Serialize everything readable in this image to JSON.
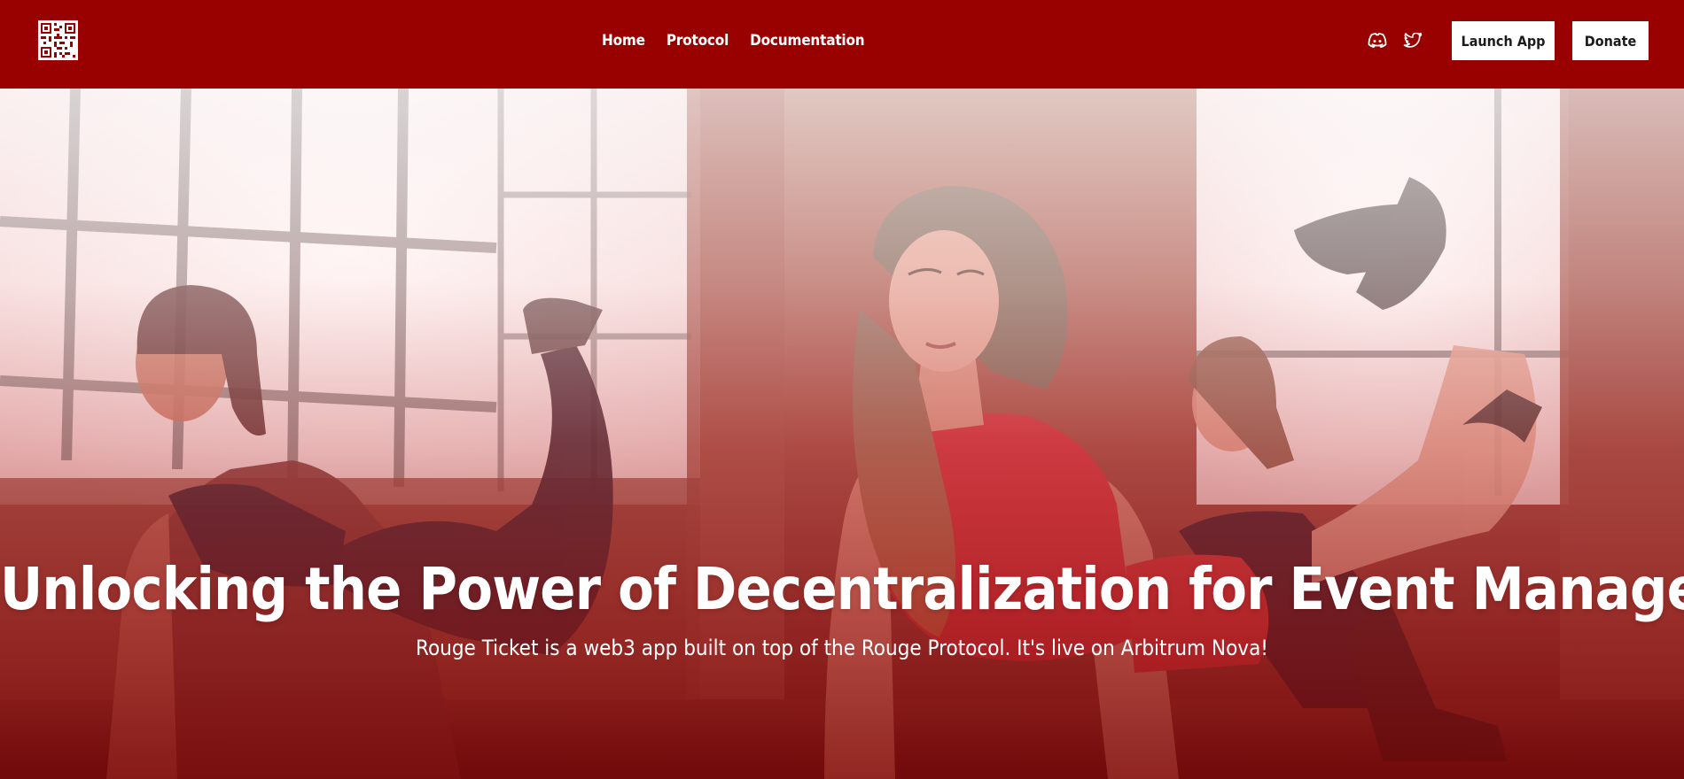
{
  "header": {
    "logo_icon": "qr-code-icon",
    "nav": [
      {
        "label": "Home"
      },
      {
        "label": "Protocol"
      },
      {
        "label": "Documentation"
      }
    ],
    "social": [
      {
        "icon": "discord-icon"
      },
      {
        "icon": "twitter-icon"
      }
    ],
    "launch_label": "Launch App",
    "donate_label": "Donate"
  },
  "hero": {
    "title": "Unlocking the Power of Decentralization for Event Management",
    "subtitle": "Rouge Ticket is a web3 app built on top of the Rouge Protocol. It's live on Arbitrum Nova!"
  },
  "colors": {
    "brand": "#990000",
    "button_bg": "#ffffff",
    "button_text": "#1b1b1b",
    "hero_text": "#ffffff"
  }
}
